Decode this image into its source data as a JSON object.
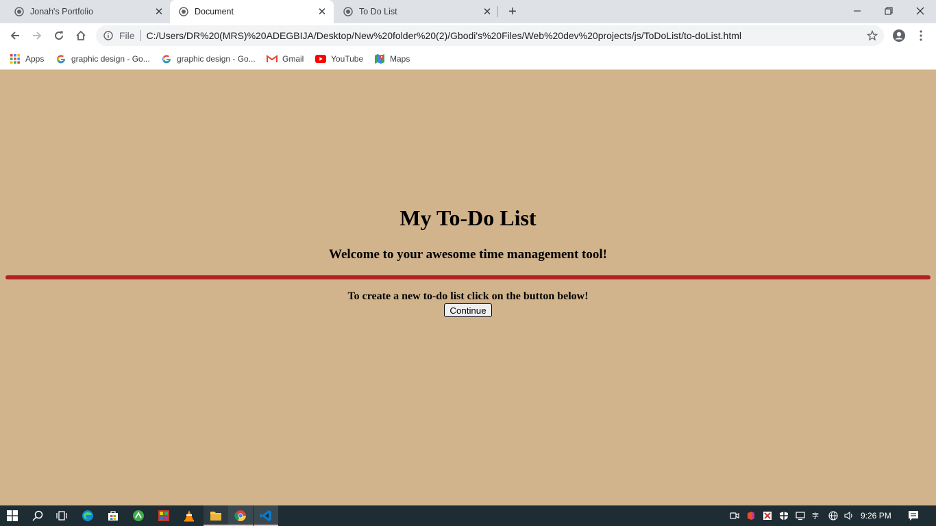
{
  "browser": {
    "tabs": [
      {
        "title": "Jonah's Portfolio",
        "active": false
      },
      {
        "title": "Document",
        "active": true
      },
      {
        "title": "To Do List",
        "active": false
      }
    ],
    "new_tab": "+",
    "address": {
      "scheme_label": "File",
      "url": "C:/Users/DR%20(MRS)%20ADEGBIJA/Desktop/New%20folder%20(2)/Gbodi's%20Files/Web%20dev%20projects/js/ToDoList/to-doList.html"
    },
    "bookmarks": [
      {
        "label": "Apps",
        "icon": "apps-grid-icon"
      },
      {
        "label": "graphic design - Go...",
        "icon": "google-icon"
      },
      {
        "label": "graphic design - Go...",
        "icon": "google-icon"
      },
      {
        "label": "Gmail",
        "icon": "gmail-icon"
      },
      {
        "label": "YouTube",
        "icon": "youtube-icon"
      },
      {
        "label": "Maps",
        "icon": "maps-icon"
      }
    ]
  },
  "page": {
    "title": "My To-Do List",
    "subtitle": "Welcome to your awesome time management tool!",
    "instruction": "To create a new to-do list click on the button below!",
    "button_label": "Continue",
    "background_color": "#d2b48c",
    "rule_color": "#b22222"
  },
  "taskbar": {
    "time": "9:26 PM",
    "apps": [
      "start-icon",
      "search-icon",
      "task-view-icon",
      "edge-icon",
      "store-icon",
      "app-green-icon",
      "app-colorful-icon",
      "vlc-icon",
      "file-explorer-icon",
      "chrome-icon",
      "vscode-icon"
    ]
  }
}
